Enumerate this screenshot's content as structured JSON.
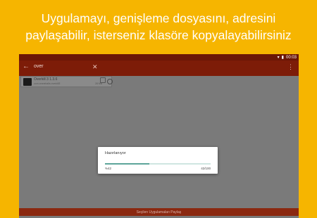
{
  "promo": {
    "line1": "Uygulamayı, genişleme dosyasını, adresini",
    "line2": "paylaşabilir, isterseniz klasöre kopyalayabilirsiniz"
  },
  "status_bar": {
    "time": "00:03"
  },
  "search": {
    "query": "over"
  },
  "app_list": [
    {
      "name": "Overkill 3 1.3.6",
      "package": "com.craneballs.overkill3",
      "size": "28 MB",
      "selected": false
    }
  ],
  "dialog": {
    "title": "Hazırlanıyor",
    "progress_percent_label": "%42",
    "progress_count_label": "42/100",
    "progress_fraction": 0.42
  },
  "bottom_bar": {
    "label": "Seçilen Uygulamaları Paylaş"
  },
  "colors": {
    "background": "#F6B500",
    "appbar": "#7D1C08",
    "statusbar": "#6B1606",
    "accent": "#5DA59A",
    "bottombar": "#8B2810"
  },
  "icons": {
    "back": "arrow-left",
    "clear": "close",
    "more": "more-vert",
    "wifi": "wifi",
    "battery": "battery"
  }
}
